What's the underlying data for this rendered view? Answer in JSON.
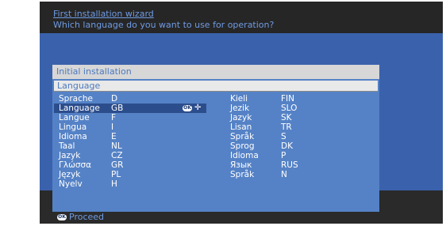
{
  "wizard": {
    "title": "First installation wizard",
    "question": "Which language do you want to use for operation?"
  },
  "panel": {
    "title": "Initial installation",
    "subtitle": "Language"
  },
  "languages_left": [
    {
      "name": "Sprache",
      "code": "D"
    },
    {
      "name": "Language",
      "code": "GB",
      "selected": true
    },
    {
      "name": "Langue",
      "code": "F"
    },
    {
      "name": "Lingua",
      "code": "I"
    },
    {
      "name": "Idioma",
      "code": "E"
    },
    {
      "name": "Taal",
      "code": "NL"
    },
    {
      "name": "Jazyk",
      "code": "CZ"
    },
    {
      "name": "Γλώσσα",
      "code": "GR"
    },
    {
      "name": "Język",
      "code": "PL"
    },
    {
      "name": "Nyelv",
      "code": "H"
    }
  ],
  "languages_right": [
    {
      "name": "Kieli",
      "code": "FIN"
    },
    {
      "name": "Jezik",
      "code": "SLO"
    },
    {
      "name": "Jazyk",
      "code": "SK"
    },
    {
      "name": "Lisan",
      "code": "TR"
    },
    {
      "name": "Språk",
      "code": "S"
    },
    {
      "name": "Sprog",
      "code": "DK"
    },
    {
      "name": "Idioma",
      "code": "P"
    },
    {
      "name": "Язык",
      "code": "RUS"
    },
    {
      "name": "Språk",
      "code": "N"
    }
  ],
  "footer": {
    "ok_icon_text": "OK",
    "proceed_label": "Proceed"
  },
  "icons": {
    "ok": "ok-button-icon",
    "navigate": "four-way-arrows-icon"
  },
  "colors": {
    "accent": "#6f9be3",
    "panel": "#5582c6",
    "band": "#3a62ac",
    "selected": "#2c4d8c"
  }
}
